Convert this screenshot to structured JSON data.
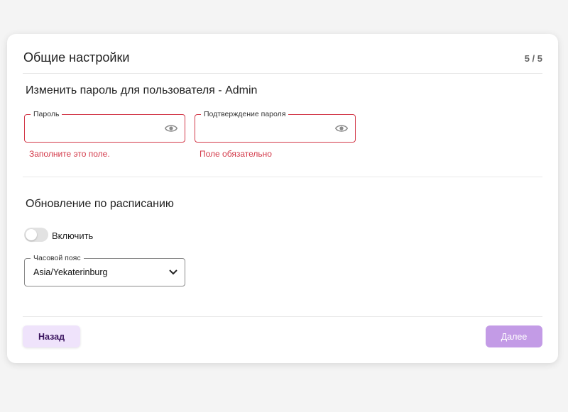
{
  "header": {
    "title": "Общие настройки",
    "step": "5 / 5"
  },
  "password_section": {
    "title": "Изменить пароль для пользователя - Admin",
    "password": {
      "label": "Пароль",
      "value": "",
      "error": "Заполните это поле."
    },
    "confirm": {
      "label": "Подтверждение пароля",
      "value": "",
      "error": "Поле обязательно"
    },
    "visibility_icon": "eye-icon"
  },
  "schedule_section": {
    "title": "Обновление по расписанию",
    "toggle_label": "Включить",
    "toggle_on": false,
    "timezone": {
      "label": "Часовой пояс",
      "value": "Asia/Yekaterinburg"
    }
  },
  "footer": {
    "back_label": "Назад",
    "next_label": "Далее"
  },
  "colors": {
    "error": "#d33a4a",
    "primary_disabled": "#c39be6",
    "secondary_bg": "#efe3fb"
  }
}
